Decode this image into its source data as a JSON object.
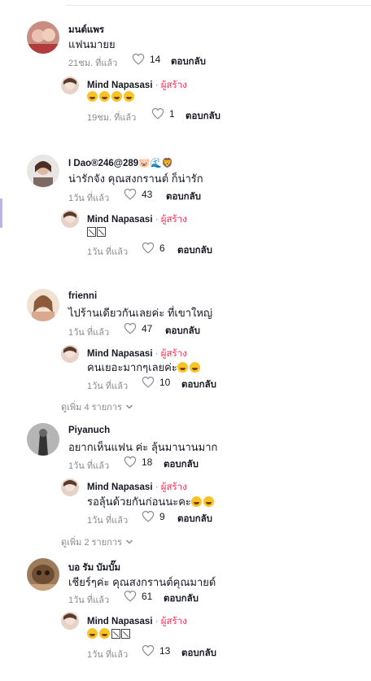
{
  "ui": {
    "reply_label": "ตอบกลับ",
    "creator_tag": "ผู้สร้าง",
    "separator": "·"
  },
  "comments": [
    {
      "author": "มนต์แพร",
      "text": "แฟนมายย",
      "time": "21ชม. ที่แล้ว",
      "likes": "14",
      "avatar_color": "#c98d82",
      "reply": {
        "author": "Mind Napasasi",
        "text_emojis": 4,
        "time": "19ชม. ที่แล้ว",
        "likes": "1"
      }
    },
    {
      "author": "I Dao®246@289🐷🌊🦁",
      "text": "น่ารักจัง คุณสงกรานต์ ก็น่ารัก",
      "time": "1วัน ที่แล้ว",
      "likes": "43",
      "avatar_color": "#7d6a63",
      "reply": {
        "author": "Mind Napasasi",
        "text_boxes": 2,
        "time": "1วัน ที่แล้ว",
        "likes": "6"
      }
    },
    {
      "author": "frienni",
      "text": "ไปร้านเดียวกันเลยค่ะ ที่เขาใหญ่",
      "time": "1วัน ที่แล้ว",
      "likes": "47",
      "avatar_color": "#d9a98f",
      "reply": {
        "author": "Mind Napasasi",
        "text": "คนเยอะมากๆเลยค่ะ",
        "text_emojis": 2,
        "time": "1วัน ที่แล้ว",
        "likes": "10"
      },
      "view_more": "ดูเพิ่ม 4 รายการ"
    },
    {
      "author": "Piyanuch",
      "text": "อยากเห็นแฟน ค่ะ ลุ้นมานานมาก",
      "time": "1วัน ที่แล้ว",
      "likes": "18",
      "avatar_color": "#9a9a9a",
      "reply": {
        "author": "Mind Napasasi",
        "text": "รอลุ้นด้วยกันก่อนนะคะ",
        "text_emojis": 2,
        "time": "1วัน ที่แล้ว",
        "likes": "9"
      },
      "view_more": "ดูเพิ่ม 2 รายการ"
    },
    {
      "author": "บอ รัม บัมบั๊ม",
      "text": "เชียร์ๆค่ะ คุณสงกรานต์คุณมายด์",
      "time": "1วัน ที่แล้ว",
      "likes": "61",
      "avatar_color": "#8a6a4c",
      "reply": {
        "author": "Mind Napasasi",
        "text_emojis": 2,
        "text_boxes": 2,
        "time": "1วัน ที่แล้ว",
        "likes": "13"
      }
    }
  ]
}
